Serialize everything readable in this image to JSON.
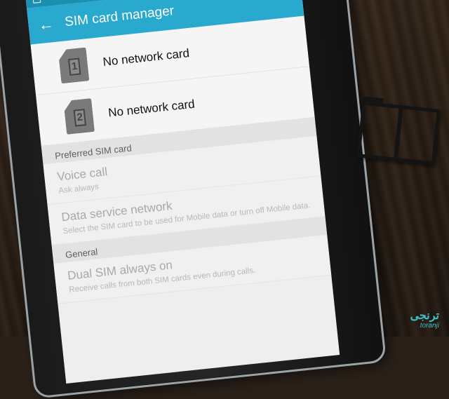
{
  "app_bar": {
    "title": "SIM card manager",
    "back_icon": "arrow-left-icon"
  },
  "status_bar": {
    "icon": "image-icon"
  },
  "sims": [
    {
      "number": "1",
      "label": "No network card"
    },
    {
      "number": "2",
      "label": "No network card"
    }
  ],
  "preferred": {
    "header": "Preferred SIM card",
    "voice_call": {
      "title": "Voice call",
      "subtitle": "Ask always"
    },
    "data_service": {
      "title": "Data service network",
      "subtitle": "Select the SIM card to be used for Mobile data or turn off Mobile data."
    }
  },
  "general": {
    "header": "General",
    "dual_sim": {
      "title": "Dual SIM always on",
      "subtitle": "Receive calls from both SIM cards even during calls."
    }
  },
  "watermark": {
    "logo": "ترنجی",
    "text": "toranji"
  },
  "colors": {
    "status_bar": "#1a8fb0",
    "app_bar": "#2aa9cf",
    "watermark": "#38c3c9"
  }
}
